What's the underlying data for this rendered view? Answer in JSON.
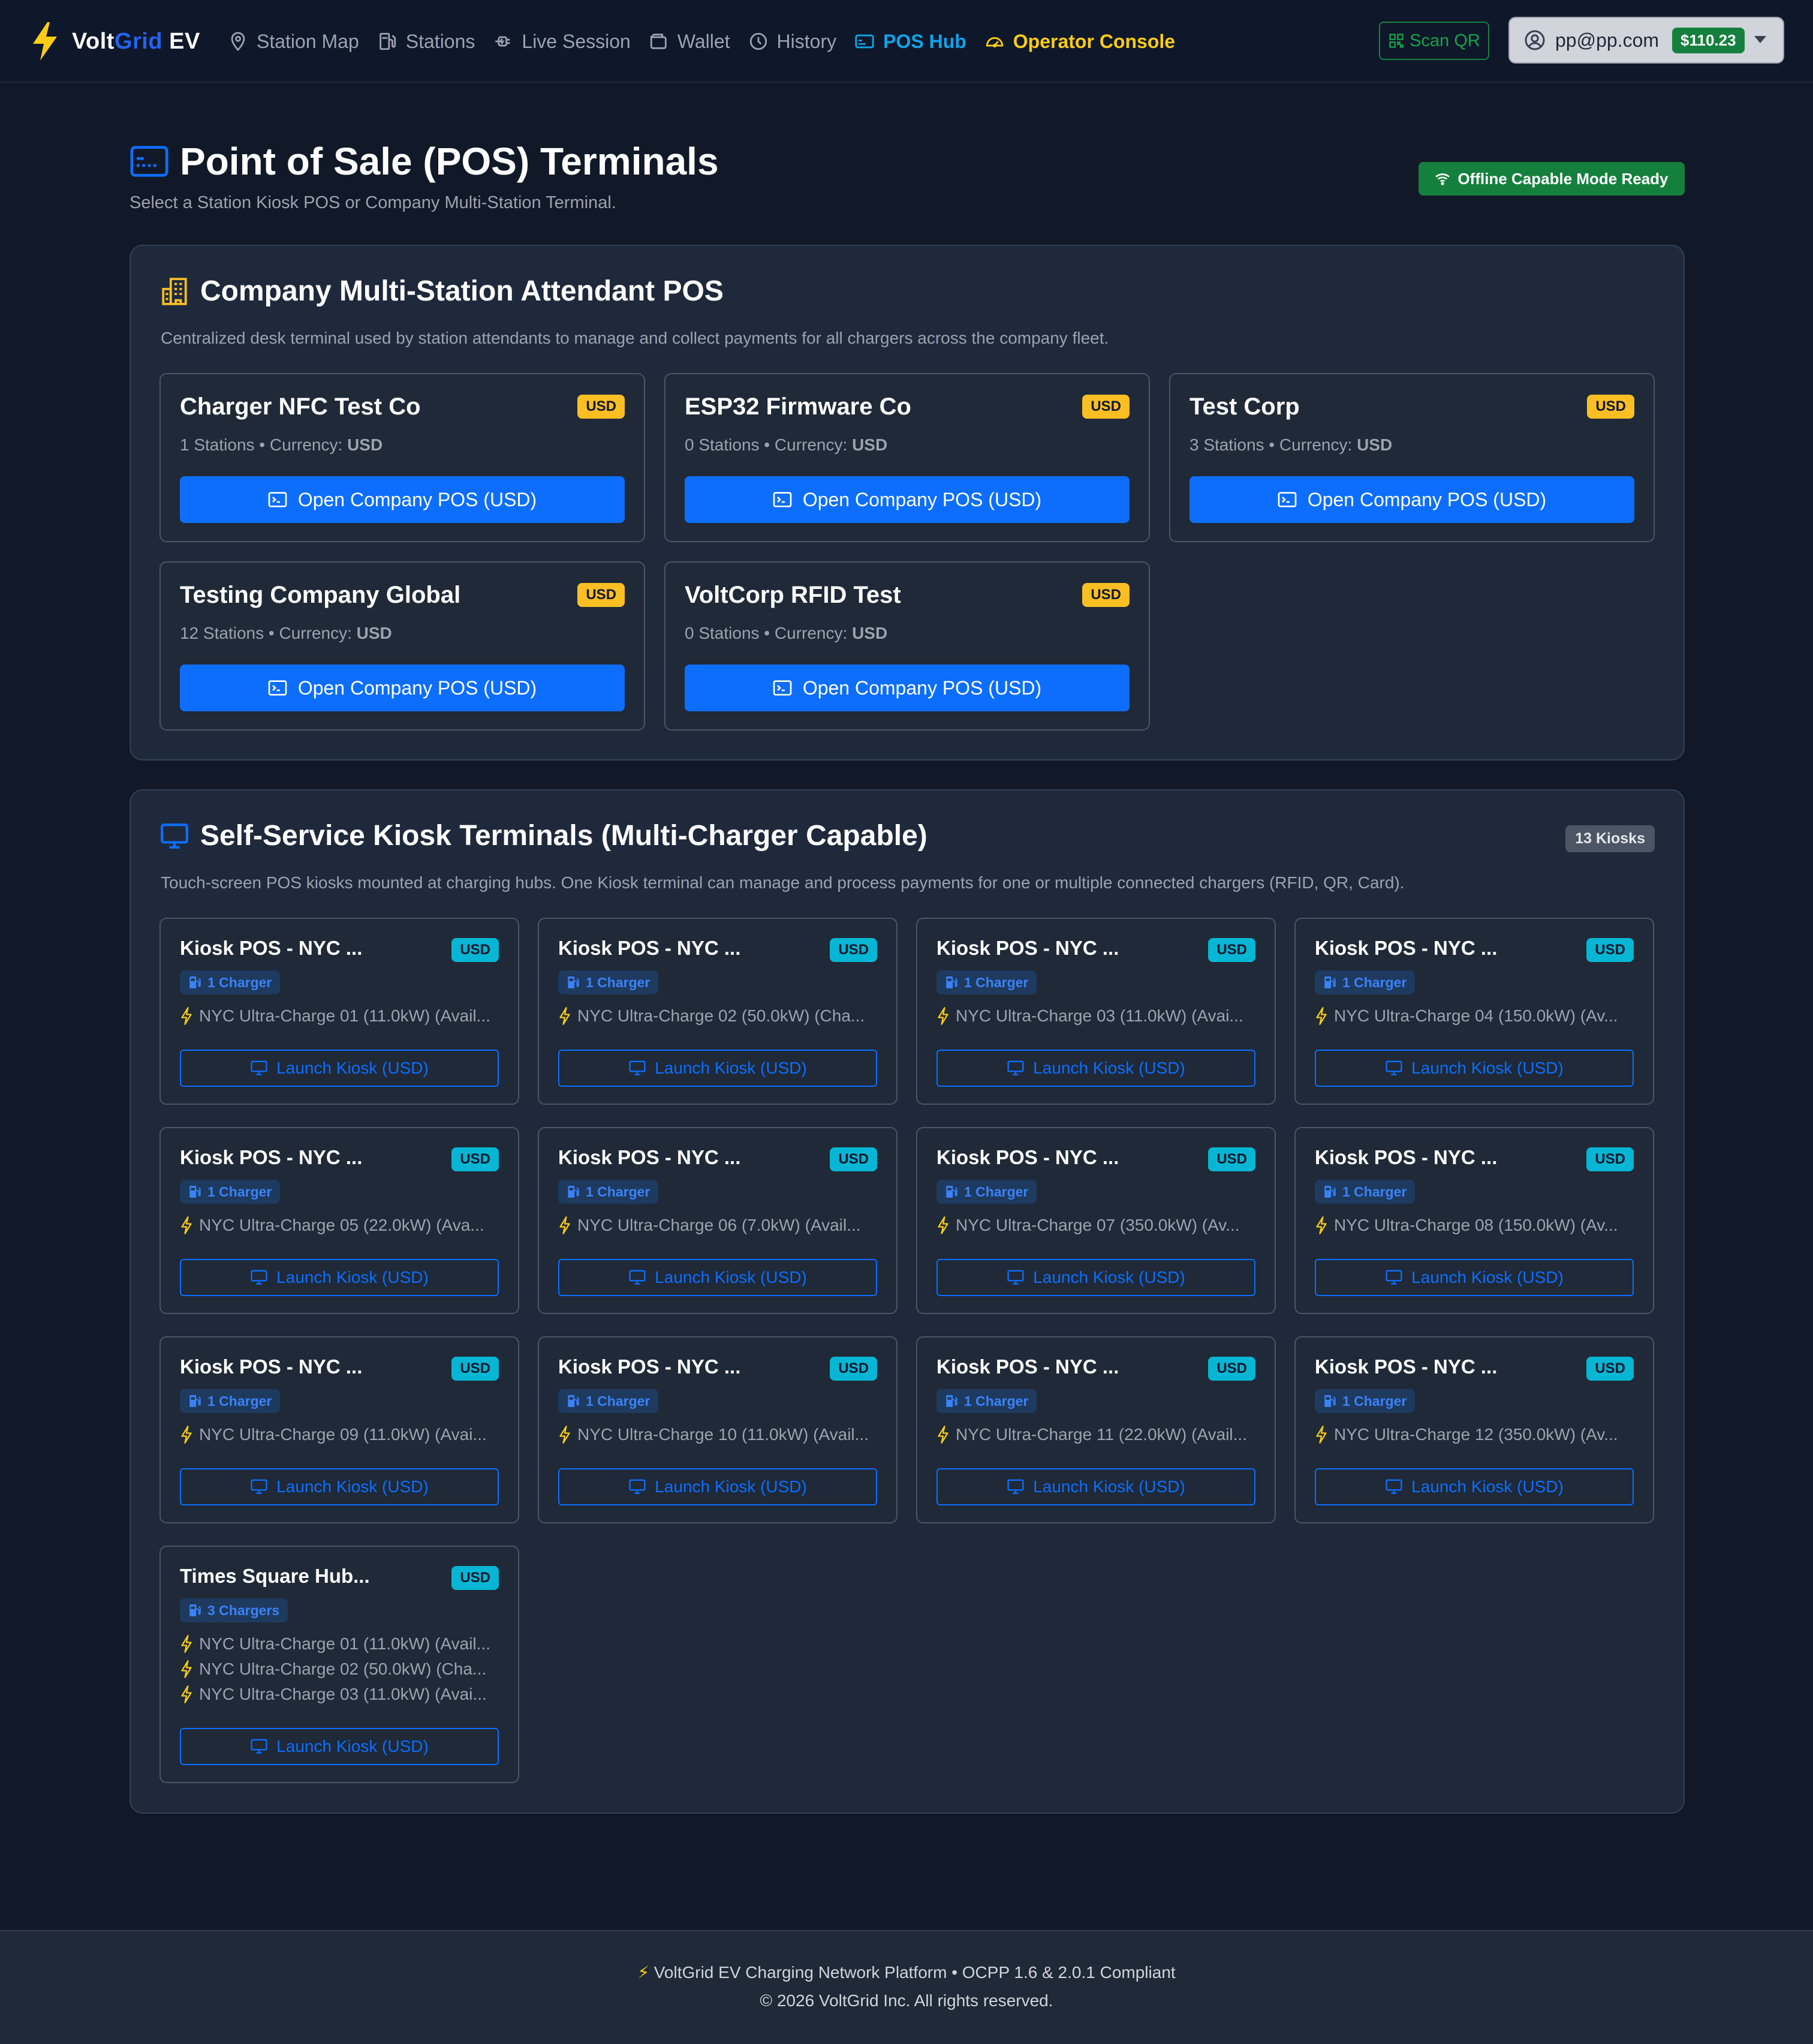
{
  "brand": {
    "name_a": "Volt",
    "name_b": "Grid",
    "name_c": " EV"
  },
  "nav": {
    "items": [
      {
        "label": "Station Map",
        "icon": "map-pin-icon"
      },
      {
        "label": "Stations",
        "icon": "fuel-pump-icon"
      },
      {
        "label": "Live Session",
        "icon": "ev-plug-icon"
      },
      {
        "label": "Wallet",
        "icon": "wallet-icon"
      },
      {
        "label": "History",
        "icon": "clock-icon"
      },
      {
        "label": "POS Hub",
        "icon": "pos-terminal-icon",
        "active": true
      },
      {
        "label": "Operator Console",
        "icon": "speedometer-icon"
      }
    ],
    "scan_qr": "Scan QR",
    "user_email": "pp@pp.com",
    "balance": "$110.23"
  },
  "header": {
    "title": "Point of Sale (POS) Terminals",
    "subtitle": "Select a Station Kiosk POS or Company Multi-Station Terminal.",
    "offline_badge": "Offline Capable Mode Ready"
  },
  "company_section": {
    "title": "Company Multi-Station Attendant POS",
    "description": "Centralized desk terminal used by station attendants to manage and collect payments for all chargers across the company fleet.",
    "companies": [
      {
        "name": "Charger NFC Test Co",
        "currency_badge": "USD",
        "stations": "1 Stations",
        "currency_label": "Currency:",
        "currency": "USD",
        "button": "Open Company POS (USD)"
      },
      {
        "name": "ESP32 Firmware Co",
        "currency_badge": "USD",
        "stations": "0 Stations",
        "currency_label": "Currency:",
        "currency": "USD",
        "button": "Open Company POS (USD)"
      },
      {
        "name": "Test Corp",
        "currency_badge": "USD",
        "stations": "3 Stations",
        "currency_label": "Currency:",
        "currency": "USD",
        "button": "Open Company POS (USD)"
      },
      {
        "name": "Testing Company Global",
        "currency_badge": "USD",
        "stations": "12 Stations",
        "currency_label": "Currency:",
        "currency": "USD",
        "button": "Open Company POS (USD)"
      },
      {
        "name": "VoltCorp RFID Test",
        "currency_badge": "USD",
        "stations": "0 Stations",
        "currency_label": "Currency:",
        "currency": "USD",
        "button": "Open Company POS (USD)"
      }
    ]
  },
  "kiosk_section": {
    "title": "Self-Service Kiosk Terminals (Multi-Charger Capable)",
    "count_badge": "13 Kiosks",
    "description": "Touch-screen POS kiosks mounted at charging hubs. One Kiosk terminal can manage and process payments for one or multiple connected chargers (RFID, QR, Card).",
    "kiosks": [
      {
        "name": "Kiosk POS - NYC ...",
        "currency": "USD",
        "charger_count": "1 Charger",
        "chargers": [
          "NYC Ultra-Charge 01 (11.0kW) (Avail..."
        ],
        "button": "Launch Kiosk (USD)"
      },
      {
        "name": "Kiosk POS - NYC ...",
        "currency": "USD",
        "charger_count": "1 Charger",
        "chargers": [
          "NYC Ultra-Charge 02 (50.0kW) (Cha..."
        ],
        "button": "Launch Kiosk (USD)"
      },
      {
        "name": "Kiosk POS - NYC ...",
        "currency": "USD",
        "charger_count": "1 Charger",
        "chargers": [
          "NYC Ultra-Charge 03 (11.0kW) (Avai..."
        ],
        "button": "Launch Kiosk (USD)"
      },
      {
        "name": "Kiosk POS - NYC ...",
        "currency": "USD",
        "charger_count": "1 Charger",
        "chargers": [
          "NYC Ultra-Charge 04 (150.0kW) (Av..."
        ],
        "button": "Launch Kiosk (USD)"
      },
      {
        "name": "Kiosk POS - NYC ...",
        "currency": "USD",
        "charger_count": "1 Charger",
        "chargers": [
          "NYC Ultra-Charge 05 (22.0kW) (Ava..."
        ],
        "button": "Launch Kiosk (USD)"
      },
      {
        "name": "Kiosk POS - NYC ...",
        "currency": "USD",
        "charger_count": "1 Charger",
        "chargers": [
          "NYC Ultra-Charge 06 (7.0kW) (Avail..."
        ],
        "button": "Launch Kiosk (USD)"
      },
      {
        "name": "Kiosk POS - NYC ...",
        "currency": "USD",
        "charger_count": "1 Charger",
        "chargers": [
          "NYC Ultra-Charge 07 (350.0kW) (Av..."
        ],
        "button": "Launch Kiosk (USD)"
      },
      {
        "name": "Kiosk POS - NYC ...",
        "currency": "USD",
        "charger_count": "1 Charger",
        "chargers": [
          "NYC Ultra-Charge 08 (150.0kW) (Av..."
        ],
        "button": "Launch Kiosk (USD)"
      },
      {
        "name": "Kiosk POS - NYC ...",
        "currency": "USD",
        "charger_count": "1 Charger",
        "chargers": [
          "NYC Ultra-Charge 09 (11.0kW) (Avai..."
        ],
        "button": "Launch Kiosk (USD)"
      },
      {
        "name": "Kiosk POS - NYC ...",
        "currency": "USD",
        "charger_count": "1 Charger",
        "chargers": [
          "NYC Ultra-Charge 10 (11.0kW) (Avail..."
        ],
        "button": "Launch Kiosk (USD)"
      },
      {
        "name": "Kiosk POS - NYC ...",
        "currency": "USD",
        "charger_count": "1 Charger",
        "chargers": [
          "NYC Ultra-Charge 11 (22.0kW) (Avail..."
        ],
        "button": "Launch Kiosk (USD)"
      },
      {
        "name": "Kiosk POS - NYC ...",
        "currency": "USD",
        "charger_count": "1 Charger",
        "chargers": [
          "NYC Ultra-Charge 12 (350.0kW) (Av..."
        ],
        "button": "Launch Kiosk (USD)"
      },
      {
        "name": "Times Square Hub...",
        "currency": "USD",
        "charger_count": "3 Chargers",
        "chargers": [
          "NYC Ultra-Charge 01 (11.0kW) (Avail...",
          "NYC Ultra-Charge 02 (50.0kW) (Cha...",
          "NYC Ultra-Charge 03 (11.0kW) (Avai..."
        ],
        "button": "Launch Kiosk (USD)"
      }
    ]
  },
  "footer": {
    "line1": "VoltGrid EV Charging Network Platform • OCPP 1.6 & 2.0.1 Compliant",
    "line2": "© 2026 VoltGrid Inc. All rights reserved."
  },
  "colors": {
    "background": "#111827",
    "panel": "#1e293b",
    "card": "#1f2937",
    "primary_button": "#0d6efd",
    "usd_company_badge": "#fbbf24",
    "usd_kiosk_badge": "#06b6d4",
    "success": "#15803d",
    "active_nav": "#0ea5e9",
    "operator_nav": "#facc15"
  }
}
